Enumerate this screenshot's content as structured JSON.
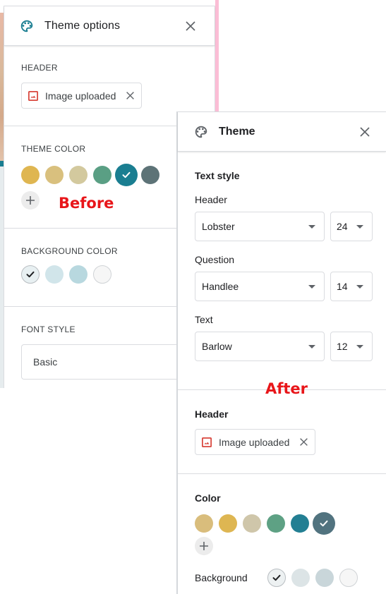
{
  "annotations": {
    "before": "Before",
    "after": "After"
  },
  "colors": {
    "annotation_red": "#e8161a",
    "accent_teal": "#1a7e91"
  },
  "before_panel": {
    "title": "Theme options",
    "icons": {
      "title": "palette-icon",
      "close": "close-icon"
    },
    "header_section": {
      "label": "HEADER",
      "chip": {
        "icon": "image-icon",
        "text": "Image uploaded",
        "remove_icon": "close-icon"
      }
    },
    "theme_color_section": {
      "label": "THEME COLOR",
      "swatches": [
        {
          "color": "#dfb651",
          "selected": false
        },
        {
          "color": "#d9c07e",
          "selected": false
        },
        {
          "color": "#d3c99e",
          "selected": false
        },
        {
          "color": "#5a9f84",
          "selected": false
        },
        {
          "color": "#1a7e91",
          "selected": true
        },
        {
          "color": "#5d7377",
          "selected": false
        }
      ],
      "add_button_icon": "plus-icon"
    },
    "background_color_section": {
      "label": "BACKGROUND COLOR",
      "swatches": [
        {
          "color": "#e8f0f2",
          "selected": true
        },
        {
          "color": "#d1e5ea",
          "selected": false
        },
        {
          "color": "#b8d8df",
          "selected": false
        },
        {
          "color": "#f6f6f6",
          "selected": false
        }
      ]
    },
    "font_style_section": {
      "label": "FONT STYLE",
      "value": "Basic"
    }
  },
  "after_panel": {
    "title": "Theme",
    "icons": {
      "title": "palette-icon",
      "close": "close-icon"
    },
    "text_style": {
      "title": "Text style",
      "rows": [
        {
          "label": "Header",
          "font": "Lobster",
          "size": "24"
        },
        {
          "label": "Question",
          "font": "Handlee",
          "size": "14"
        },
        {
          "label": "Text",
          "font": "Barlow",
          "size": "12"
        }
      ]
    },
    "header_section": {
      "title": "Header",
      "chip": {
        "icon": "image-icon",
        "text": "Image uploaded",
        "remove_icon": "close-icon"
      }
    },
    "color_section": {
      "title": "Color",
      "swatches": [
        {
          "color": "#d9bd7c",
          "selected": false
        },
        {
          "color": "#deb652",
          "selected": false
        },
        {
          "color": "#cfc6aa",
          "selected": false
        },
        {
          "color": "#5ea184",
          "selected": false
        },
        {
          "color": "#237f93",
          "selected": false
        },
        {
          "color": "#51737f",
          "selected": true
        }
      ],
      "add_button_icon": "plus-icon",
      "background_label": "Background",
      "background_swatches": [
        {
          "color": "#edf1f2",
          "selected": true
        },
        {
          "color": "#dce4e6",
          "selected": false
        },
        {
          "color": "#c9d6da",
          "selected": false
        },
        {
          "color": "#f6f6f6",
          "selected": false
        }
      ]
    }
  }
}
